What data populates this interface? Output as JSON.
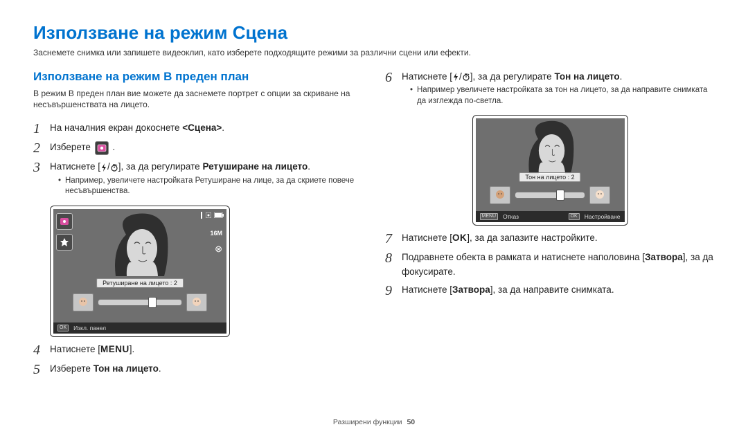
{
  "title": "Използване на режим Сцена",
  "subtitle": "Заснемете снимка или запишете видеоклип, като изберете подходящите режими за различни сцени или ефекти.",
  "left": {
    "heading": "Използване на режим В преден план",
    "desc": "В режим В преден план вие можете да заснемете портрет с опции за скриване на несъвършенствата на лицето.",
    "steps": [
      {
        "num": "1",
        "prefix": "На началния екран докоснете ",
        "bold": "<Сцена>",
        "suffix": "."
      },
      {
        "num": "2",
        "prefix": "Изберете ",
        "icon": "mode-icon",
        "suffix": " ."
      },
      {
        "num": "3",
        "prefix": "Натиснете [",
        "icons": "flash-timer",
        "mid": "], за да регулирате ",
        "bold": "Ретуширане на лицето",
        "suffix": ".",
        "bullet": "Например, увеличете настройката Ретуширане на лице, за да скриете повече несъвършенства."
      },
      {
        "num": "4",
        "prefix": "Натиснете [",
        "bold_code": "MENU",
        "suffix": "]."
      },
      {
        "num": "5",
        "prefix": "Изберете ",
        "bold": "Тон на лицето",
        "suffix": "."
      }
    ],
    "screen": {
      "label": "Ретуширане на лицето : 2",
      "footer_btn": "OK",
      "footer_text": "Изкл. панел",
      "res": "16M"
    }
  },
  "right": {
    "steps": [
      {
        "num": "6",
        "prefix": "Натиснете [",
        "icons": "flash-timer",
        "mid": "], за да регулирате ",
        "bold": "Тон на лицето",
        "suffix": ".",
        "bullet": "Например увеличете настройката за тон на лицето, за да направите снимката да изглежда по-светла."
      },
      {
        "num": "7",
        "prefix": "Натиснете [",
        "bold_code": "OK",
        "suffix": "], за да запазите настройките."
      },
      {
        "num": "8",
        "prefix": "Подравнете обекта в рамката и натиснете наполовина [",
        "bold": "Затвора",
        "suffix": "], за да фокусирате."
      },
      {
        "num": "9",
        "prefix": "Натиснете [",
        "bold": "Затвора",
        "suffix": "], за да направите снимката."
      }
    ],
    "screen": {
      "label": "Тон на лицето : 2",
      "footer_left_btn": "MENU",
      "footer_left_text": "Отказ",
      "footer_right_btn": "OK",
      "footer_right_text": "Настройване"
    }
  },
  "footer": {
    "text": "Разширени функции",
    "page": "50"
  }
}
